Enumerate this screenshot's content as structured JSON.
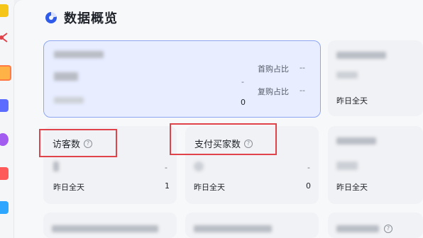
{
  "page": {
    "title": "数据概览"
  },
  "sidebar": {
    "apps": [
      {
        "name": "app-1",
        "color": "#f5c518"
      },
      {
        "name": "app-2",
        "color": "#e0434a"
      },
      {
        "name": "app-3",
        "color": "#ff9f43"
      },
      {
        "name": "app-4",
        "color": "#5b6cff"
      },
      {
        "name": "app-5",
        "color": "#a25cf0"
      },
      {
        "name": "app-6",
        "color": "#ff5a5a"
      },
      {
        "name": "app-7",
        "color": "#2da6ff"
      }
    ]
  },
  "feature_card": {
    "first_purchase_label": "首购占比",
    "first_purchase_value": "--",
    "repeat_purchase_label": "复购占比",
    "repeat_purchase_value": "--",
    "value_dash": "-",
    "value_zero": "0"
  },
  "right_card_top": {
    "footer_label": "昨日全天"
  },
  "visitors_card": {
    "label": "访客数",
    "value_dash": "-",
    "footer_label": "昨日全天",
    "footer_value": "1"
  },
  "buyers_card": {
    "label": "支付买家数",
    "value_dash": "-",
    "footer_label": "昨日全天",
    "footer_value": "0"
  },
  "right_card_mid": {
    "footer_label": "昨日全天"
  },
  "accent_color": "#2f5bea",
  "highlight_color": "#e0434a"
}
